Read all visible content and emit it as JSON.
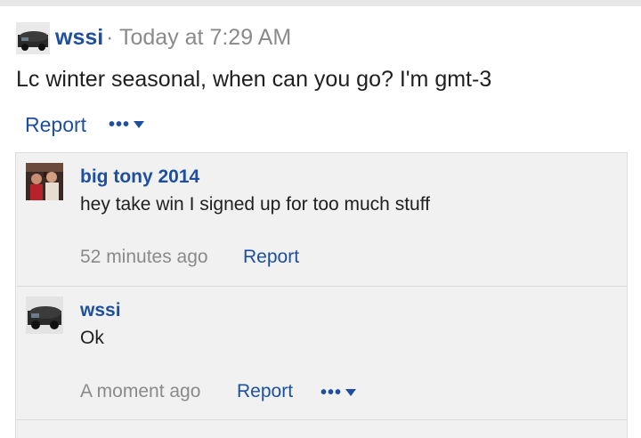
{
  "post": {
    "author": "wssi",
    "separator": "·",
    "time": "Today at 7:29 AM",
    "body": "Lc winter seasonal, when can you go? I'm gmt-3",
    "report_label": "Report",
    "more_label": "•••"
  },
  "replies": [
    {
      "author": "big tony 2014",
      "body": "hey take win I signed up for too much stuff",
      "time": "52 minutes ago",
      "report_label": "Report"
    },
    {
      "author": "wssi",
      "body": "Ok",
      "time": "A moment ago",
      "report_label": "Report",
      "more_label": "•••"
    }
  ],
  "colors": {
    "link": "#1d4fa0",
    "muted": "#8a8a8a",
    "reply_bg": "#f1f1f1"
  }
}
